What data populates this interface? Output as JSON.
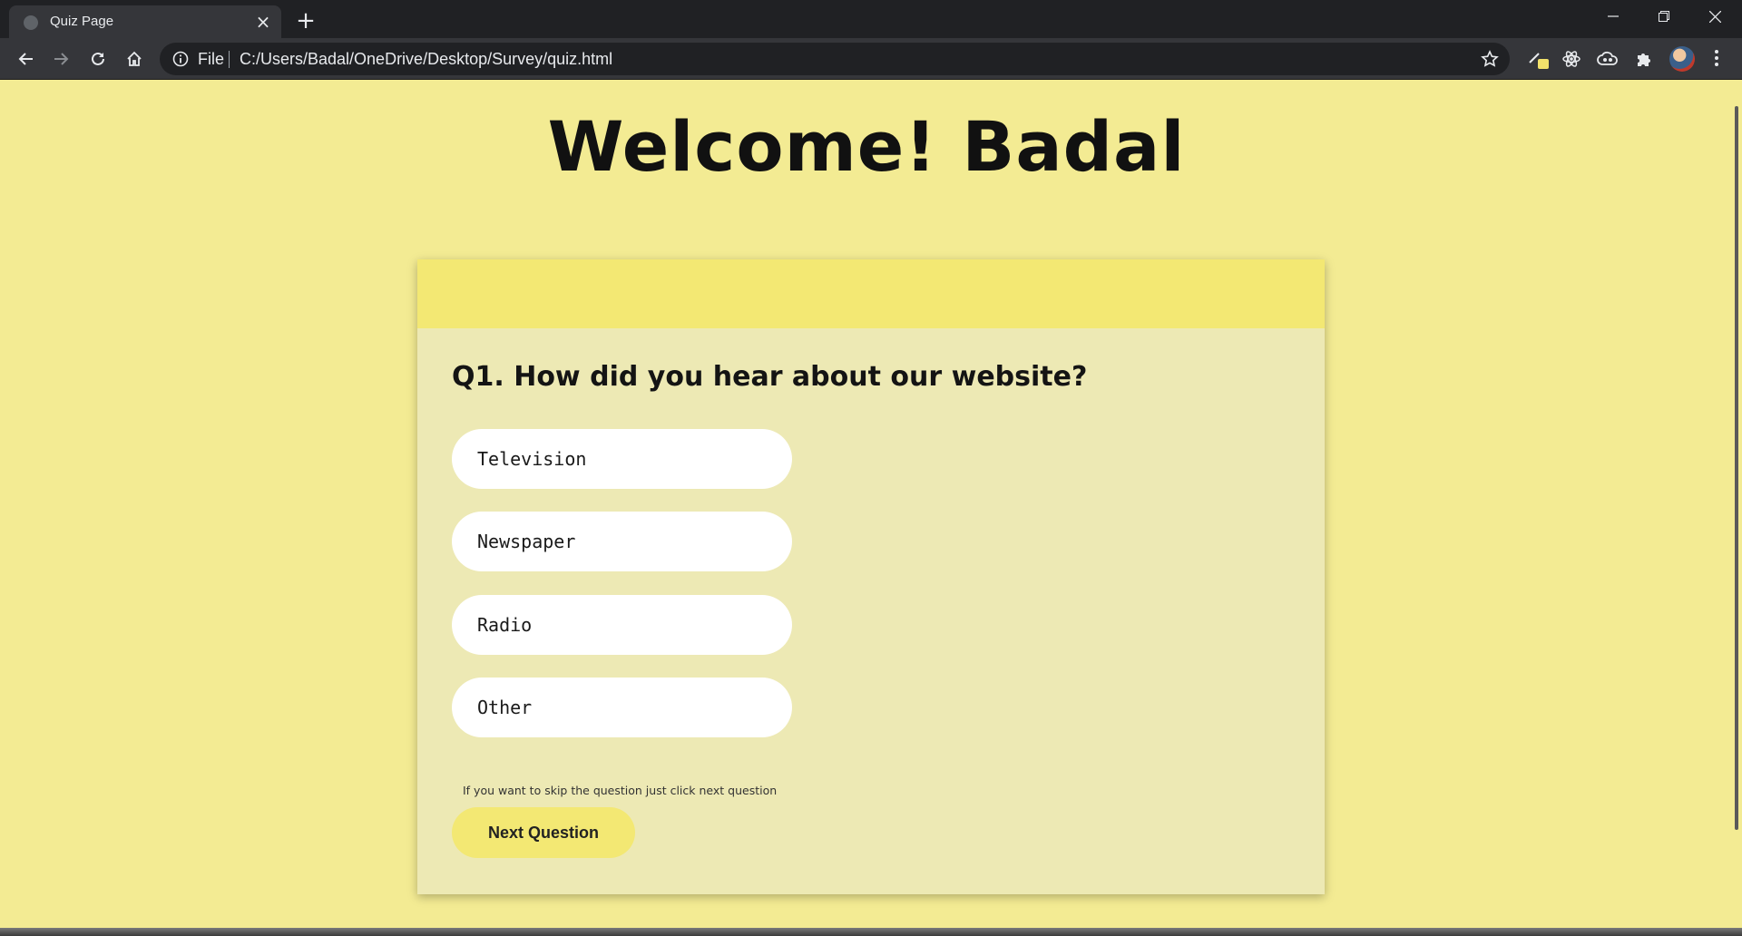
{
  "browser": {
    "tab_title": "Quiz Page",
    "tab_close": "×",
    "new_tab": "+",
    "omnibox": {
      "scheme_label": "File",
      "url": "C:/Users/Badal/OneDrive/Desktop/Survey/quiz.html"
    },
    "icons": {
      "back": "back-arrow-icon",
      "forward": "forward-arrow-icon",
      "reload": "reload-icon",
      "home": "home-icon",
      "info": "info-icon",
      "star": "bookmark-star-icon",
      "extensions": [
        "highlighter-extension-icon",
        "react-devtools-icon",
        "cloud-extension-icon",
        "puzzle-extensions-icon"
      ],
      "window": [
        "minimize-icon",
        "restore-icon",
        "close-window-icon"
      ]
    }
  },
  "page": {
    "welcome_heading": "Welcome! Badal",
    "question": "Q1. How did you hear about our website?",
    "options": [
      "Television",
      "Newspaper",
      "Radio",
      "Other"
    ],
    "skip_hint": "If you want to skip the question just click next question",
    "next_button_label": "Next Question"
  },
  "colors": {
    "page_background": "#f3eb93",
    "card_background": "#ede9b4",
    "card_header": "#f3e873",
    "button": "#f3e873",
    "option_background": "#ffffff"
  }
}
